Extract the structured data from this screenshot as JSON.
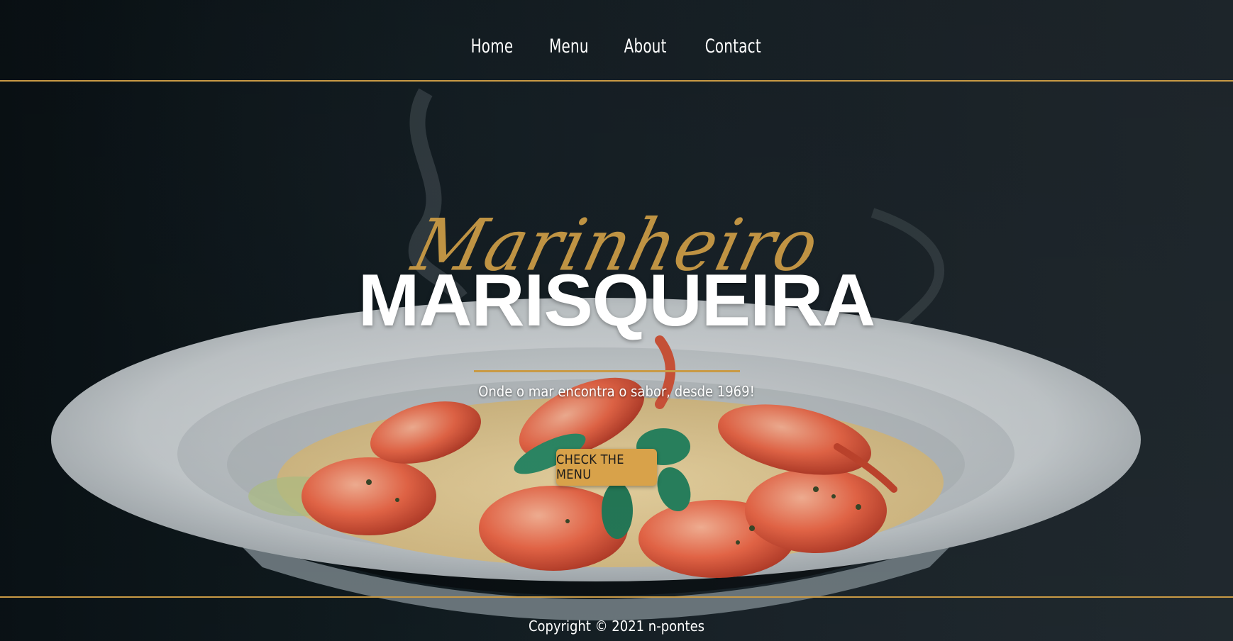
{
  "nav": {
    "items": [
      {
        "label": "Home"
      },
      {
        "label": "Menu"
      },
      {
        "label": "About"
      },
      {
        "label": "Contact"
      }
    ]
  },
  "hero": {
    "script_title": "Marinheiro",
    "title": "MARISQUEIRA",
    "tagline": "Onde o mar encontra o sabor, desde 1969!",
    "cta_label": "CHECK THE MENU",
    "background_image": "shrimp-risotto-plate-photo"
  },
  "footer": {
    "copyright": "Copyright © 2021 n-pontes"
  },
  "colors": {
    "accent": "#c99a45",
    "button": "#d8a24a",
    "background": "#0c1418",
    "text": "#ffffff"
  }
}
